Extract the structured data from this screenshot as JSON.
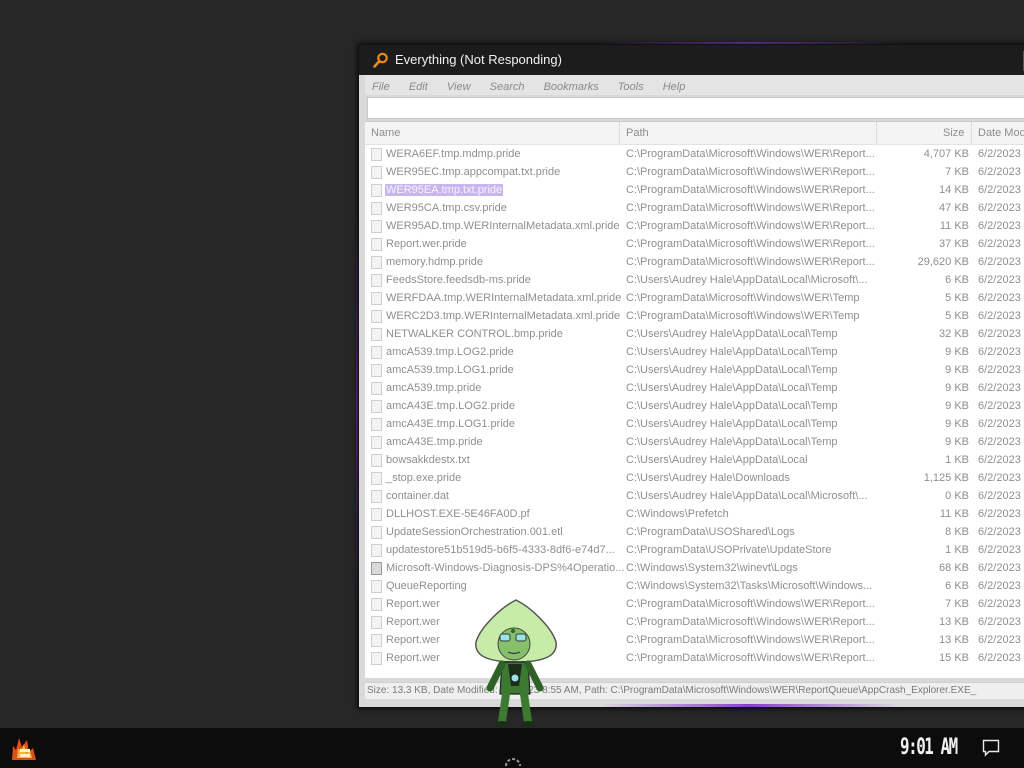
{
  "window": {
    "title": "Everything (Not Responding)",
    "menu": [
      "File",
      "Edit",
      "View",
      "Search",
      "Bookmarks",
      "Tools",
      "Help"
    ],
    "search_value": "",
    "columns": {
      "name": "Name",
      "path": "Path",
      "size": "Size",
      "date": "Date Mod"
    },
    "rows": [
      {
        "name": "WERA6EF.tmp.mdmp.pride",
        "path": "C:\\ProgramData\\Microsoft\\Windows\\WER\\Report...",
        "size": "4,707 KB",
        "date": "6/2/2023"
      },
      {
        "name": "WER95EC.tmp.appcompat.txt.pride",
        "path": "C:\\ProgramData\\Microsoft\\Windows\\WER\\Report...",
        "size": "7 KB",
        "date": "6/2/2023"
      },
      {
        "name": "WER95EA.tmp.txt.pride",
        "path": "C:\\ProgramData\\Microsoft\\Windows\\WER\\Report...",
        "size": "14 KB",
        "date": "6/2/2023",
        "selected": true
      },
      {
        "name": "WER95CA.tmp.csv.pride",
        "path": "C:\\ProgramData\\Microsoft\\Windows\\WER\\Report...",
        "size": "47 KB",
        "date": "6/2/2023"
      },
      {
        "name": "WER95AD.tmp.WERInternalMetadata.xml.pride",
        "path": "C:\\ProgramData\\Microsoft\\Windows\\WER\\Report...",
        "size": "11 KB",
        "date": "6/2/2023"
      },
      {
        "name": "Report.wer.pride",
        "path": "C:\\ProgramData\\Microsoft\\Windows\\WER\\Report...",
        "size": "37 KB",
        "date": "6/2/2023"
      },
      {
        "name": "memory.hdmp.pride",
        "path": "C:\\ProgramData\\Microsoft\\Windows\\WER\\Report...",
        "size": "29,620 KB",
        "date": "6/2/2023"
      },
      {
        "name": "FeedsStore.feedsdb-ms.pride",
        "path": "C:\\Users\\Audrey Hale\\AppData\\Local\\Microsoft\\...",
        "size": "6 KB",
        "date": "6/2/2023"
      },
      {
        "name": "WERFDAA.tmp.WERInternalMetadata.xml.pride",
        "path": "C:\\ProgramData\\Microsoft\\Windows\\WER\\Temp",
        "size": "5 KB",
        "date": "6/2/2023"
      },
      {
        "name": "WERC2D3.tmp.WERInternalMetadata.xml.pride",
        "path": "C:\\ProgramData\\Microsoft\\Windows\\WER\\Temp",
        "size": "5 KB",
        "date": "6/2/2023"
      },
      {
        "name": "NETWALKER CONTROL.bmp.pride",
        "path": "C:\\Users\\Audrey Hale\\AppData\\Local\\Temp",
        "size": "32 KB",
        "date": "6/2/2023"
      },
      {
        "name": "amcA539.tmp.LOG2.pride",
        "path": "C:\\Users\\Audrey Hale\\AppData\\Local\\Temp",
        "size": "9 KB",
        "date": "6/2/2023"
      },
      {
        "name": "amcA539.tmp.LOG1.pride",
        "path": "C:\\Users\\Audrey Hale\\AppData\\Local\\Temp",
        "size": "9 KB",
        "date": "6/2/2023"
      },
      {
        "name": "amcA539.tmp.pride",
        "path": "C:\\Users\\Audrey Hale\\AppData\\Local\\Temp",
        "size": "9 KB",
        "date": "6/2/2023"
      },
      {
        "name": "amcA43E.tmp.LOG2.pride",
        "path": "C:\\Users\\Audrey Hale\\AppData\\Local\\Temp",
        "size": "9 KB",
        "date": "6/2/2023"
      },
      {
        "name": "amcA43E.tmp.LOG1.pride",
        "path": "C:\\Users\\Audrey Hale\\AppData\\Local\\Temp",
        "size": "9 KB",
        "date": "6/2/2023"
      },
      {
        "name": "amcA43E.tmp.pride",
        "path": "C:\\Users\\Audrey Hale\\AppData\\Local\\Temp",
        "size": "9 KB",
        "date": "6/2/2023"
      },
      {
        "name": "bowsakkdestx.txt",
        "path": "C:\\Users\\Audrey Hale\\AppData\\Local",
        "size": "1 KB",
        "date": "6/2/2023"
      },
      {
        "name": "_stop.exe.pride",
        "path": "C:\\Users\\Audrey Hale\\Downloads",
        "size": "1,125 KB",
        "date": "6/2/2023"
      },
      {
        "name": "container.dat",
        "path": "C:\\Users\\Audrey Hale\\AppData\\Local\\Microsoft\\...",
        "size": "0 KB",
        "date": "6/2/2023"
      },
      {
        "name": "DLLHOST.EXE-5E46FA0D.pf",
        "path": "C:\\Windows\\Prefetch",
        "size": "11 KB",
        "date": "6/2/2023"
      },
      {
        "name": "UpdateSessionOrchestration.001.etl",
        "path": "C:\\ProgramData\\USOShared\\Logs",
        "size": "8 KB",
        "date": "6/2/2023"
      },
      {
        "name": "updatestore51b519d5-b6f5-4333-8df6-e74d7...",
        "path": "C:\\ProgramData\\USOPrivate\\UpdateStore",
        "size": "1 KB",
        "date": "6/2/2023"
      },
      {
        "name": "Microsoft-Windows-Diagnosis-DPS%4Operatio...",
        "path": "C:\\Windows\\System32\\winevt\\Logs",
        "size": "68 KB",
        "date": "6/2/2023",
        "img": true
      },
      {
        "name": "QueueReporting",
        "path": "C:\\Windows\\System32\\Tasks\\Microsoft\\Windows...",
        "size": "6 KB",
        "date": "6/2/2023"
      },
      {
        "name": "Report.wer",
        "path": "C:\\ProgramData\\Microsoft\\Windows\\WER\\Report...",
        "size": "7 KB",
        "date": "6/2/2023"
      },
      {
        "name": "Report.wer",
        "path": "C:\\ProgramData\\Microsoft\\Windows\\WER\\Report...",
        "size": "13 KB",
        "date": "6/2/2023"
      },
      {
        "name": "Report.wer",
        "path": "C:\\ProgramData\\Microsoft\\Windows\\WER\\Report...",
        "size": "13 KB",
        "date": "6/2/2023"
      },
      {
        "name": "Report.wer",
        "path": "C:\\ProgramData\\Microsoft\\Windows\\WER\\Report...",
        "size": "15 KB",
        "date": "6/2/2023"
      }
    ],
    "status": "Size: 13.3 KB, Date Modified: 6/2/2023 8:55 AM, Path: C:\\ProgramData\\Microsoft\\Windows\\WER\\ReportQueue\\AppCrash_Explorer.EXE_"
  },
  "taskbar": {
    "clock": "9:01 AM"
  },
  "colors": {
    "accent": "#8a3fd1",
    "selection": "#c9b6ee",
    "mascot_green": "#a7d38c"
  }
}
